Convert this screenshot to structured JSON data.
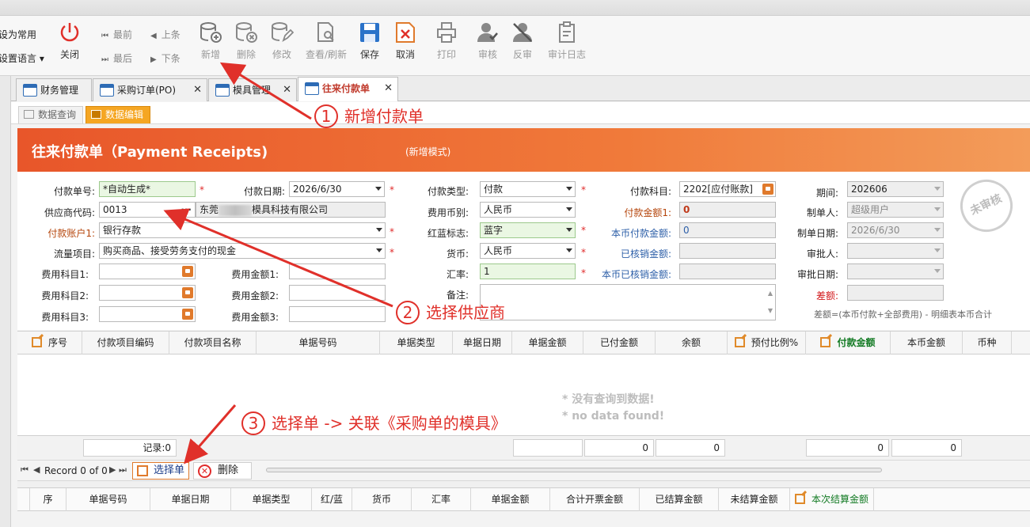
{
  "toolbar": {
    "left_items": [
      "设为常用",
      "设置语言"
    ],
    "close": "关闭",
    "first": "最前",
    "prev": "上条",
    "last": "最后",
    "next": "下条",
    "buttons": [
      "新增",
      "删除",
      "修改",
      "查看/刷新",
      "保存",
      "取消",
      "打印",
      "审核",
      "反审",
      "审计日志"
    ]
  },
  "tabs": [
    {
      "label": "财务管理"
    },
    {
      "label": "采购订单(PO)"
    },
    {
      "label": "模具管理"
    },
    {
      "label": "往来付款单"
    }
  ],
  "subtabs": [
    "数据查询",
    "数据编辑"
  ],
  "banner": {
    "title": "往来付款单（Payment Receipts)",
    "mode": "(新增模式)"
  },
  "form": {
    "pay_no_label": "付款单号:",
    "pay_no": "*自动生成*",
    "pay_date_label": "付款日期:",
    "pay_date": "2026/6/30",
    "pay_type_label": "付款类型:",
    "pay_type": "付款",
    "pay_subject_label": "付款科目:",
    "pay_subject": "2202[应付账款]",
    "period_label": "期间:",
    "period": "202606",
    "supplier_label": "供应商代码:",
    "supplier_code": "0013",
    "supplier_name_pre": "东莞",
    "supplier_name_post": "模具科技有限公司",
    "fee_currency_label": "费用币别:",
    "fee_currency": "人民币",
    "pay_amount_label": "付款金额1:",
    "pay_amount": "0",
    "creator_label": "制单人:",
    "creator": "超级用户",
    "account_label": "付款账户1:",
    "account": "银行存款",
    "redblue_label": "红蓝标志:",
    "redblue": "蓝字",
    "local_pay_label": "本币付款金额:",
    "local_pay": "0",
    "create_date_label": "制单日期:",
    "create_date": "2026/6/30",
    "flow_label": "流量项目:",
    "flow": "购买商品、接受劳务支付的现金",
    "currency_label": "货币:",
    "currency": "人民币",
    "verified_label": "已核销金额:",
    "approver_label": "审批人:",
    "fee_subj1_label": "费用科目1:",
    "fee_amt1_label": "费用金额1:",
    "rate_label": "汇率:",
    "rate": "1",
    "local_verified_label": "本币已核销金额:",
    "approve_date_label": "审批日期:",
    "fee_subj2_label": "费用科目2:",
    "fee_amt2_label": "费用金额2:",
    "remark_label": "备注:",
    "diff_label": "差额:",
    "fee_subj3_label": "费用科目3:",
    "fee_amt3_label": "费用金额3:",
    "diff_note": "差额=(本币付款+全部费用) - 明细表本币合计",
    "stamp": "未审核"
  },
  "grid": {
    "columns": [
      "序号",
      "付款项目编码",
      "付款项目名称",
      "单据号码",
      "单据类型",
      "单据日期",
      "单据金额",
      "已付金额",
      "余额",
      "预付比例%",
      "付款金额",
      "本币金额",
      "币种"
    ],
    "nodata1": "* 没有查询到数据!",
    "nodata2": "* no data found!",
    "records": "记录:0",
    "sums": [
      "0",
      "0",
      "0",
      "0"
    ]
  },
  "navbar": {
    "record": "Record 0 of 0",
    "select": "选择单",
    "delete": "删除"
  },
  "grid2": {
    "columns": [
      "序",
      "单据号码",
      "单据日期",
      "单据类型",
      "红/蓝",
      "货币",
      "汇率",
      "单据金额",
      "合计开票金额",
      "已结算金额",
      "未结算金额",
      "本次结算金额"
    ]
  },
  "annotations": {
    "a1_num": "1",
    "a1": "新增付款单",
    "a2_num": "2",
    "a2": "选择供应商",
    "a3_num": "3",
    "a3": "选择单 -> 关联《采购单的模具》"
  }
}
